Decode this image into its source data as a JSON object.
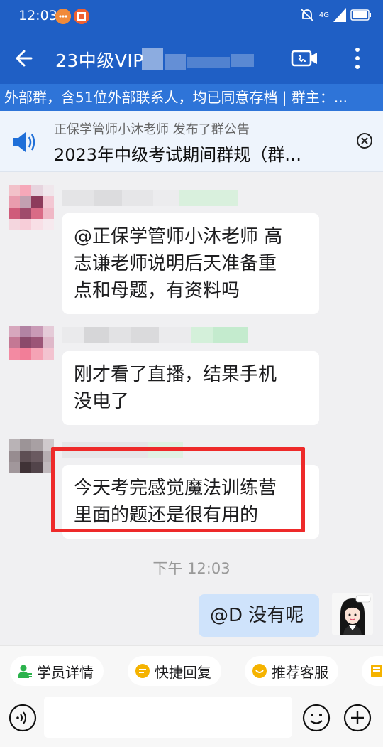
{
  "status": {
    "time": "12:03",
    "network": "4G"
  },
  "header": {
    "title": "23中级VIP",
    "info_bar": "外部群，含51位外部联系人，均已同意存档 | 群主：..."
  },
  "notice": {
    "subtitle": "正保学管师小沐老师 发布了群公告",
    "title": "2023年中级考试期间群规（群…"
  },
  "messages": [
    {
      "side": "left",
      "text_line1": "@正保学管师小沐老师 高",
      "text_line2": "志谦老师说明后天准备重",
      "text_line3": "点和母题，有资料吗"
    },
    {
      "side": "left",
      "text_line1": "刚才看了直播，结果手机",
      "text_line2": "没电了"
    },
    {
      "side": "left",
      "text_line1": "今天考完感觉魔法训练营",
      "text_line2": "里面的题还是很有用的"
    },
    {
      "side": "right",
      "text": "@D 没有呢"
    }
  ],
  "time_divider": "下午 12:03",
  "quick_replies": [
    {
      "label": "学员详情",
      "color": "#2bb24c"
    },
    {
      "label": "快捷回复",
      "color": "#f5b300"
    },
    {
      "label": "推荐客服",
      "color": "#f5b300"
    }
  ],
  "input": {
    "placeholder": ""
  },
  "colors": {
    "brand": "#1f5fc5",
    "info_bar": "#2e74d8",
    "highlight": "#ee2a2a",
    "my_bubble": "#cfe3fb"
  }
}
